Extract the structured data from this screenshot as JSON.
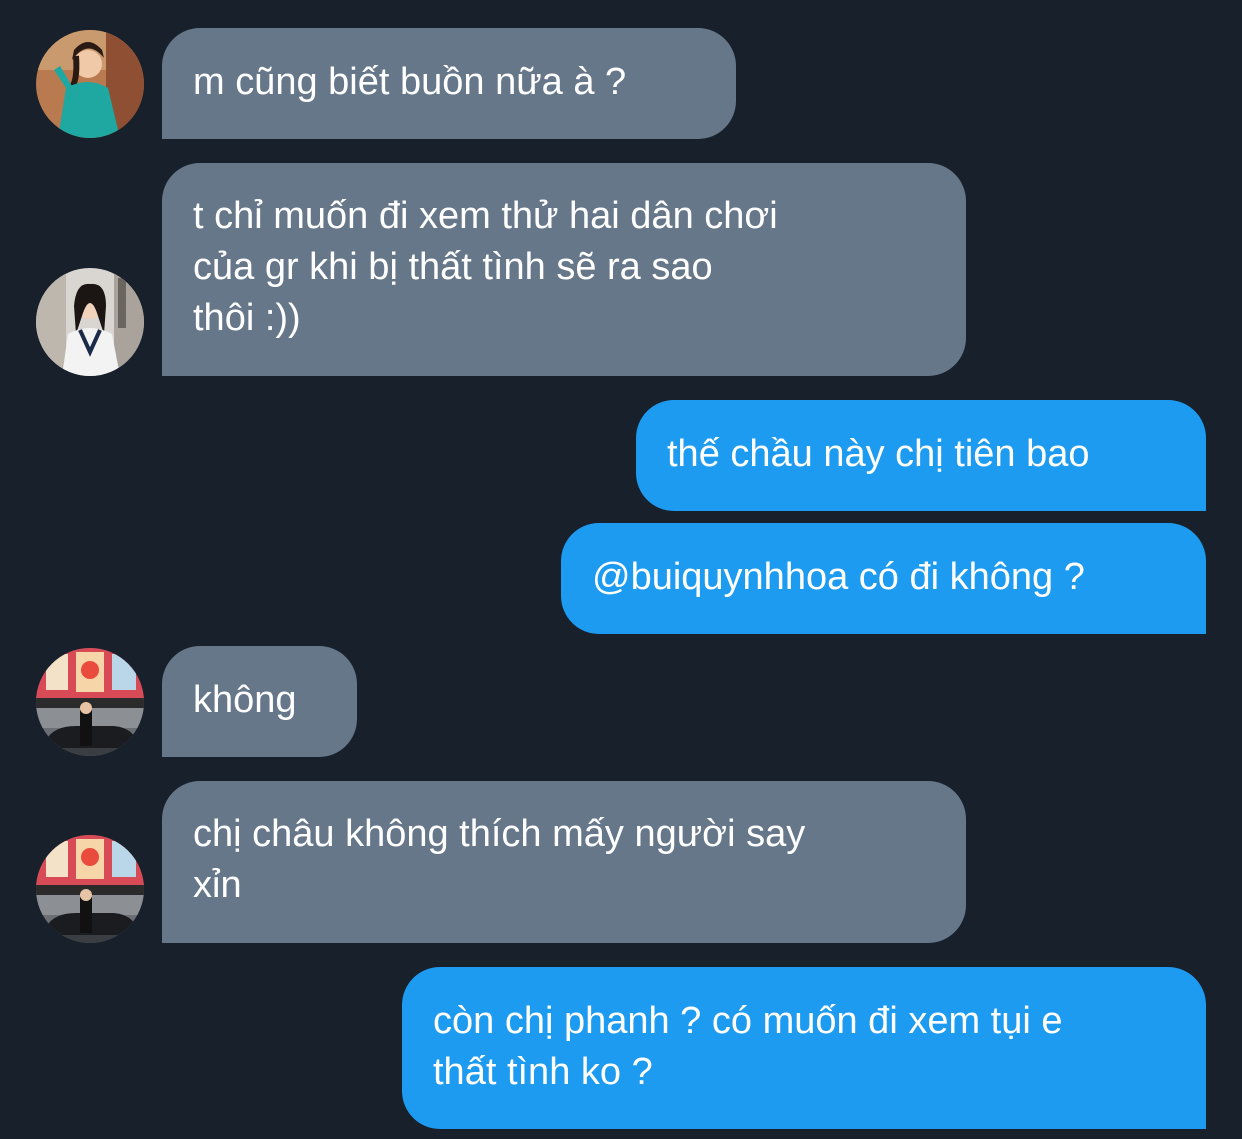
{
  "conversation": {
    "messages": [
      {
        "sender": "other",
        "lines": [
          "m cũng biết buồn nữa à ?"
        ],
        "avatar_icon": "avatar-woman-teal-dress-icon"
      },
      {
        "sender": "other",
        "lines": [
          "t chỉ muốn đi xem thử hai dân chơi",
          "của gr khi bị thất tình sẽ ra sao",
          "thôi :))"
        ],
        "avatar_icon": "avatar-woman-white-vest-icon"
      },
      {
        "sender": "self",
        "lines": [
          "thế chầu này chị tiên bao"
        ]
      },
      {
        "sender": "self",
        "lines": [
          "@buiquynhhoa có đi không ?"
        ]
      },
      {
        "sender": "other",
        "lines": [
          "không"
        ],
        "avatar_icon": "avatar-street-billboard-icon"
      },
      {
        "sender": "other",
        "lines": [
          "chị châu không thích mấy người say",
          "xỉn"
        ],
        "avatar_icon": "avatar-street-billboard-icon"
      },
      {
        "sender": "self",
        "lines": [
          "còn chị phanh ? có muốn đi xem tụi e",
          "thất tình ko ?"
        ]
      }
    ]
  },
  "colors": {
    "background": "#17202b",
    "incoming_bubble": "#66778a",
    "outgoing_bubble": "#1d9bf0",
    "text": "#ffffff"
  }
}
